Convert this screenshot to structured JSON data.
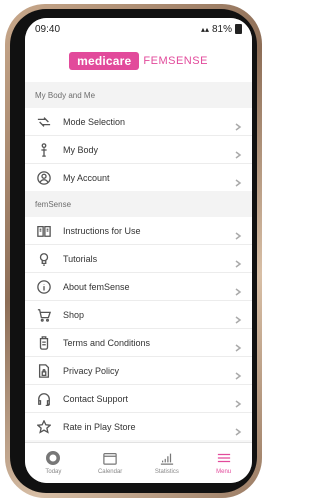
{
  "status_bar": {
    "time": "09:40",
    "battery": "81%"
  },
  "header": {
    "brand_primary": "medicare",
    "brand_secondary": "FEMSENSE"
  },
  "sections": [
    {
      "title": "My Body and Me",
      "items": [
        {
          "label": "Mode Selection",
          "icon": "switch-icon"
        },
        {
          "label": "My Body",
          "icon": "body-icon"
        },
        {
          "label": "My Account",
          "icon": "account-icon"
        }
      ]
    },
    {
      "title": "femSense",
      "items": [
        {
          "label": "Instructions for Use",
          "icon": "book-icon"
        },
        {
          "label": "Tutorials",
          "icon": "bulb-icon"
        },
        {
          "label": "About femSense",
          "icon": "info-icon"
        },
        {
          "label": "Shop",
          "icon": "cart-icon"
        },
        {
          "label": "Terms and Conditions",
          "icon": "terms-icon"
        },
        {
          "label": "Privacy Policy",
          "icon": "document-lock-icon"
        },
        {
          "label": "Contact Support",
          "icon": "headset-icon"
        },
        {
          "label": "Rate in Play Store",
          "icon": "star-icon"
        }
      ]
    }
  ],
  "nav": [
    {
      "label": "Today",
      "icon": "today-icon"
    },
    {
      "label": "Calendar",
      "icon": "calendar-icon"
    },
    {
      "label": "Statistics",
      "icon": "statistics-icon"
    },
    {
      "label": "Menu",
      "icon": "menu-icon",
      "active": true
    }
  ],
  "colors": {
    "accent": "#e24a9b",
    "text": "#333333"
  }
}
